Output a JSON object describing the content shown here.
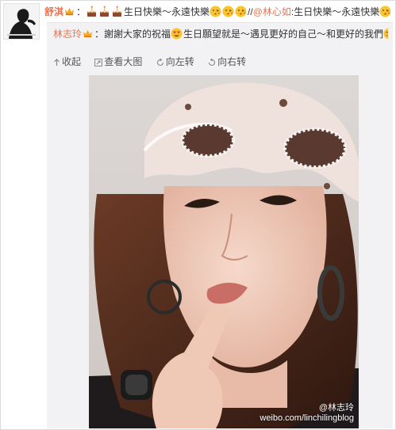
{
  "post": {
    "author": "舒淇",
    "text_birthday": "生日快樂～永遠快樂",
    "separator": "//",
    "mention": "@林心如",
    "mention_colon": ":",
    "text_birthday_2": "生日快樂～永遠快樂"
  },
  "repost": {
    "author": "林志玲",
    "colon": "：",
    "text_thanks": "謝謝大家的祝福",
    "text_wish": "生日願望就是～遇見更好的自己～和更好的我們"
  },
  "toolbar": {
    "collapse_label": "收起",
    "view_large_label": "查看大图",
    "rotate_left_label": "向左转",
    "rotate_right_label": "向右转"
  },
  "photo": {
    "watermark_handle": "@林志玲",
    "watermark_url": "weibo.com/linchilingblog"
  },
  "colors": {
    "accent": "#eb7350",
    "repost_bg": "#f2f2f5"
  },
  "icons": {
    "vip_badge": "vip-crown-icon",
    "cake": "birthday-cake-icon",
    "kiss_face": "kiss-face-icon",
    "heart_eyes": "heart-eyes-icon",
    "shy_face": "shy-face-icon",
    "collapse": "collapse-arrow-icon",
    "view_large": "view-large-icon",
    "rotate_left": "rotate-left-icon",
    "rotate_right": "rotate-right-icon"
  }
}
